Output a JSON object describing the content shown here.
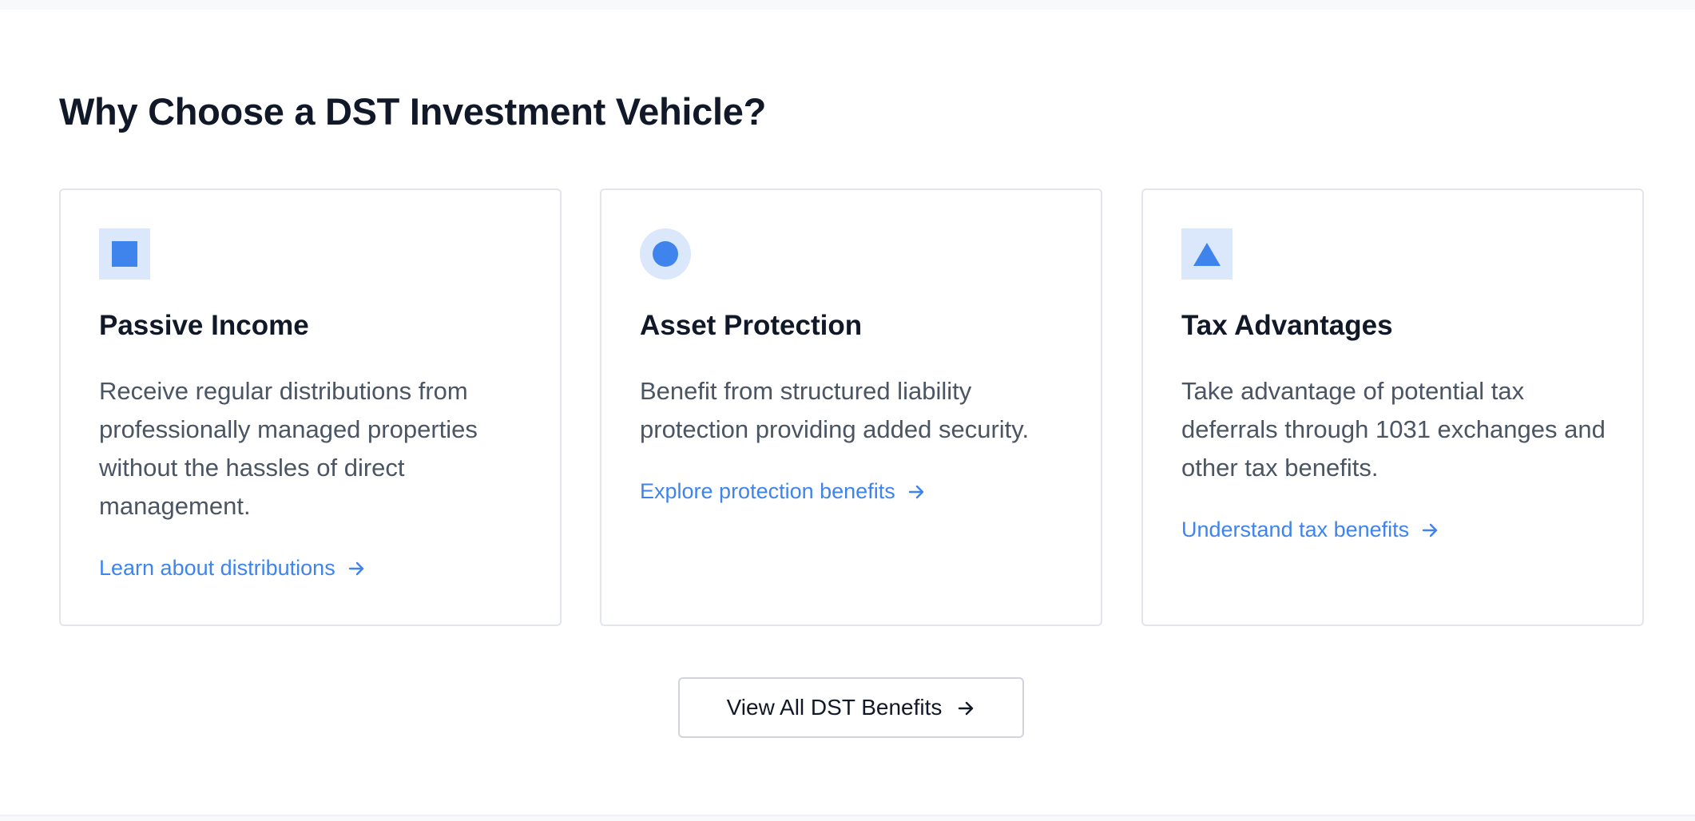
{
  "section": {
    "title": "Why Choose a DST Investment Vehicle?"
  },
  "cards": [
    {
      "icon": "square-icon",
      "title": "Passive Income",
      "description": "Receive regular distributions from professionally managed properties without the hassles of direct management.",
      "link": "Learn about distributions"
    },
    {
      "icon": "circle-icon",
      "title": "Asset Protection",
      "description": "Benefit from structured liability protection providing added security.",
      "link": "Explore protection benefits"
    },
    {
      "icon": "triangle-icon",
      "title": "Tax Advantages",
      "description": "Take advantage of potential tax deferrals through 1031 exchanges and other tax benefits.",
      "link": "Understand tax benefits"
    }
  ],
  "cta": {
    "label": "View All DST Benefits"
  },
  "colors": {
    "accent": "#3f84ec",
    "icon_bg": "#dbe8fc",
    "heading": "#111827",
    "body_text": "#4b5563",
    "border": "#e2e5ea"
  }
}
